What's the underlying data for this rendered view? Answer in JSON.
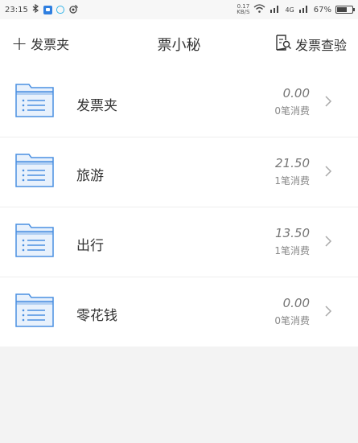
{
  "status_bar": {
    "time": "23:15",
    "net_speed_top": "0.17",
    "net_speed_bottom": "KB/S",
    "signal_label": "4G",
    "battery": "67%",
    "battery_level": 0.67
  },
  "header": {
    "add_label": "发票夹",
    "title": "票小秘",
    "verify_label": "发票查验"
  },
  "folders": [
    {
      "name": "发票夹",
      "amount": "0.00",
      "count": "0笔消费"
    },
    {
      "name": "旅游",
      "amount": "21.50",
      "count": "1笔消费"
    },
    {
      "name": "出行",
      "amount": "13.50",
      "count": "1笔消费"
    },
    {
      "name": "零花钱",
      "amount": "0.00",
      "count": "0笔消费"
    }
  ],
  "colors": {
    "folder_stroke": "#4a90e2",
    "folder_fill": "#e8f1fc",
    "background": "#f3f3f3"
  }
}
